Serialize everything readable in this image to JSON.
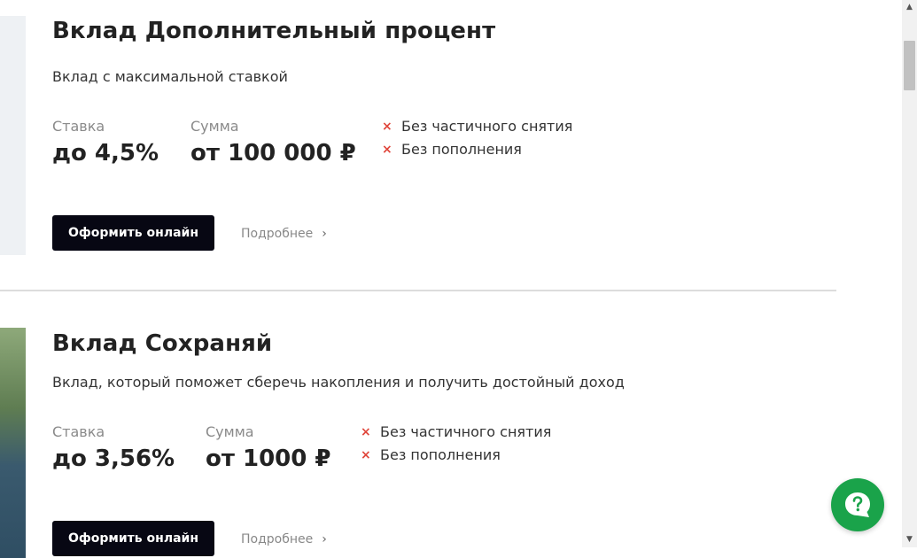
{
  "products": [
    {
      "title": "Вклад Дополнительный процент",
      "subtitle": "Вклад с максимальной ставкой",
      "rate_label": "Ставка",
      "rate_value": "до 4,5%",
      "amount_label": "Сумма",
      "amount_value": "от 100 000 ₽",
      "features": [
        "Без частичного снятия",
        "Без пополнения"
      ],
      "apply_label": "Оформить онлайн",
      "more_label": "Подробнее"
    },
    {
      "title": "Вклад Сохраняй",
      "subtitle": "Вклад, который поможет сберечь накопления и получить достойный доход",
      "rate_label": "Ставка",
      "rate_value": "до 3,56%",
      "amount_label": "Сумма",
      "amount_value": "от 1000 ₽",
      "features": [
        "Без частичного снятия",
        "Без пополнения"
      ],
      "apply_label": "Оформить онлайн",
      "more_label": "Подробнее"
    }
  ],
  "icons": {
    "feature_unavailable": "×",
    "more_chevron": "›",
    "chat": "question-chat-icon"
  },
  "colors": {
    "accent_button": "#070713",
    "cross": "#e0453a",
    "chat": "#1aa34a"
  }
}
